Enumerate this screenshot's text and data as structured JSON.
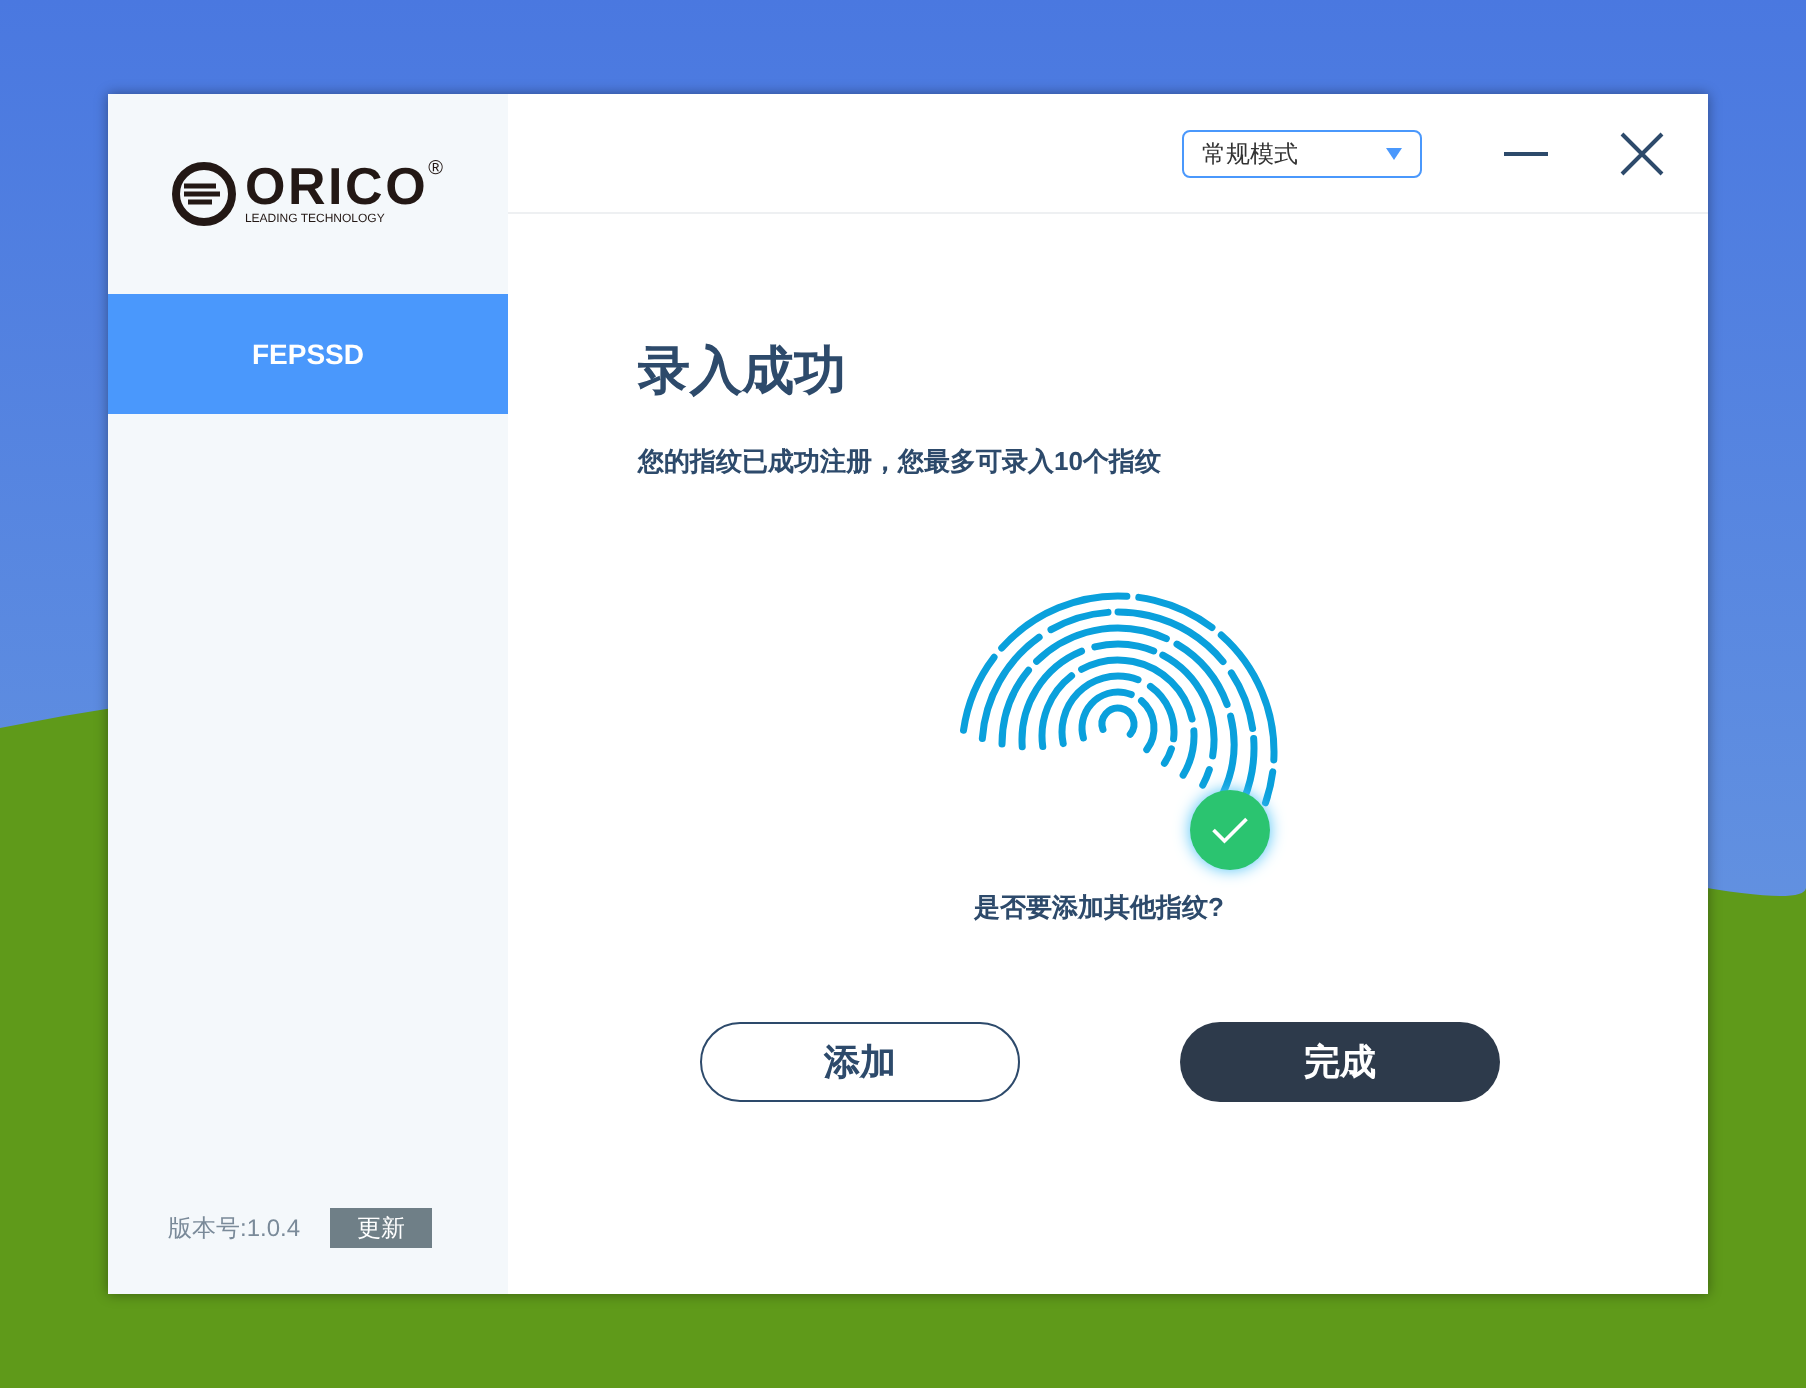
{
  "logo": {
    "brand": "ORICO",
    "registered": "®",
    "tagline": "LEADING TECHNOLOGY"
  },
  "sidebar": {
    "items": [
      {
        "label": "FEPSSD",
        "selected": true
      }
    ],
    "version": "版本号:1.0.4",
    "update_button": "更新"
  },
  "header": {
    "mode_select": {
      "value": "常规模式"
    }
  },
  "content": {
    "title": "录入成功",
    "message": "您的指纹已成功注册，您最多可录入10个指纹",
    "question": "是否要添加其他指纹?"
  },
  "buttons": [
    {
      "label": "添加",
      "kind": "outline"
    },
    {
      "label": "完成",
      "kind": "primary"
    }
  ]
}
